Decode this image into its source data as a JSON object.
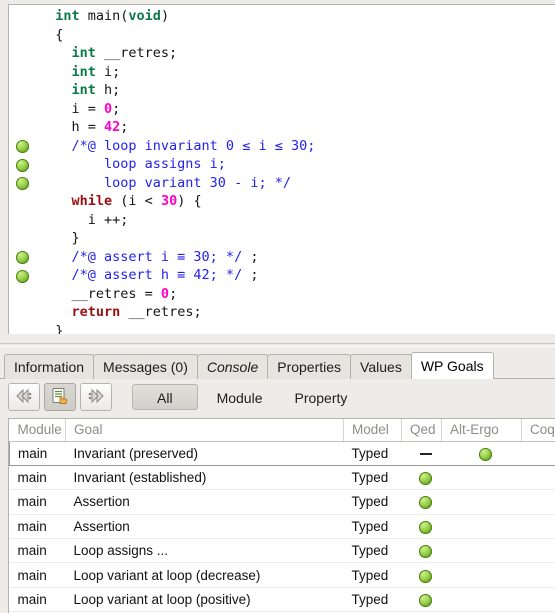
{
  "source": {
    "language": "C",
    "lines": [
      {
        "gutter": false,
        "tokens": [
          {
            "t": "  ",
            "c": "pl"
          },
          {
            "t": "int ",
            "c": "ty"
          },
          {
            "t": "main(",
            "c": "pl"
          },
          {
            "t": "void",
            "c": "ty"
          },
          {
            "t": ")",
            "c": "pl"
          }
        ]
      },
      {
        "gutter": false,
        "tokens": [
          {
            "t": "  {",
            "c": "pl"
          }
        ]
      },
      {
        "gutter": false,
        "tokens": [
          {
            "t": "    ",
            "c": "pl"
          },
          {
            "t": "int",
            "c": "ty"
          },
          {
            "t": " __retres;",
            "c": "pl"
          }
        ]
      },
      {
        "gutter": false,
        "tokens": [
          {
            "t": "    ",
            "c": "pl"
          },
          {
            "t": "int",
            "c": "ty"
          },
          {
            "t": " i;",
            "c": "pl"
          }
        ]
      },
      {
        "gutter": false,
        "tokens": [
          {
            "t": "    ",
            "c": "pl"
          },
          {
            "t": "int",
            "c": "ty"
          },
          {
            "t": " h;",
            "c": "pl"
          }
        ]
      },
      {
        "gutter": false,
        "tokens": [
          {
            "t": "    i = ",
            "c": "pl"
          },
          {
            "t": "0",
            "c": "num"
          },
          {
            "t": ";",
            "c": "pl"
          }
        ]
      },
      {
        "gutter": false,
        "tokens": [
          {
            "t": "    h = ",
            "c": "pl"
          },
          {
            "t": "42",
            "c": "num"
          },
          {
            "t": ";",
            "c": "pl"
          }
        ]
      },
      {
        "gutter": true,
        "tokens": [
          {
            "t": "    /*@ loop invariant 0 ≤ i ≤ 30;",
            "c": "acsl"
          }
        ]
      },
      {
        "gutter": true,
        "tokens": [
          {
            "t": "        loop assigns i;",
            "c": "acsl"
          }
        ]
      },
      {
        "gutter": true,
        "tokens": [
          {
            "t": "        loop variant 30 - i; */",
            "c": "acsl"
          }
        ]
      },
      {
        "gutter": false,
        "tokens": [
          {
            "t": "    ",
            "c": "pl"
          },
          {
            "t": "while",
            "c": "kw"
          },
          {
            "t": " (i < ",
            "c": "pl"
          },
          {
            "t": "30",
            "c": "num"
          },
          {
            "t": ") {",
            "c": "pl"
          }
        ]
      },
      {
        "gutter": false,
        "tokens": [
          {
            "t": "      i ++;",
            "c": "pl"
          }
        ]
      },
      {
        "gutter": false,
        "tokens": [
          {
            "t": "    }",
            "c": "pl"
          }
        ]
      },
      {
        "gutter": true,
        "tokens": [
          {
            "t": "    /*@ assert i ≡ 30; */",
            "c": "acsl"
          },
          {
            "t": " ;",
            "c": "pl"
          }
        ]
      },
      {
        "gutter": true,
        "tokens": [
          {
            "t": "    /*@ assert h ≡ 42; */",
            "c": "acsl"
          },
          {
            "t": " ;",
            "c": "pl"
          }
        ]
      },
      {
        "gutter": false,
        "tokens": [
          {
            "t": "    __retres = ",
            "c": "pl"
          },
          {
            "t": "0",
            "c": "num"
          },
          {
            "t": ";",
            "c": "pl"
          }
        ]
      },
      {
        "gutter": false,
        "tokens": [
          {
            "t": "    ",
            "c": "pl"
          },
          {
            "t": "return",
            "c": "kw"
          },
          {
            "t": " __retres;",
            "c": "pl"
          }
        ]
      },
      {
        "gutter": false,
        "tokens": [
          {
            "t": "  }",
            "c": "pl"
          }
        ]
      }
    ]
  },
  "dock": {
    "tabs": [
      {
        "label": "Information",
        "active": false,
        "italic": false
      },
      {
        "label": "Messages (0)",
        "active": false,
        "italic": false
      },
      {
        "label": "Console",
        "active": false,
        "italic": true
      },
      {
        "label": "Properties",
        "active": false,
        "italic": false
      },
      {
        "label": "Values",
        "active": false,
        "italic": false
      },
      {
        "label": "WP Goals",
        "active": true,
        "italic": false
      }
    ],
    "toolbar": {
      "back_icon": "previous-goal-icon",
      "inspect_icon": "goal-source-icon",
      "forward_icon": "next-goal-icon",
      "scope_all": "All",
      "scope_module": "Module",
      "scope_property": "Property"
    },
    "table": {
      "columns": [
        "Module",
        "Goal",
        "Model",
        "Qed",
        "Alt-Ergo",
        "Coq"
      ],
      "rows": [
        {
          "module": "main",
          "goal": "Invariant (preserved)",
          "model": "Typed",
          "qed": "dash",
          "alt_ergo": "valid",
          "coq": "",
          "selected": true
        },
        {
          "module": "main",
          "goal": "Invariant (established)",
          "model": "Typed",
          "qed": "valid",
          "alt_ergo": "",
          "coq": "",
          "selected": false
        },
        {
          "module": "main",
          "goal": "Assertion",
          "model": "Typed",
          "qed": "valid",
          "alt_ergo": "",
          "coq": "",
          "selected": false
        },
        {
          "module": "main",
          "goal": "Assertion",
          "model": "Typed",
          "qed": "valid",
          "alt_ergo": "",
          "coq": "",
          "selected": false
        },
        {
          "module": "main",
          "goal": "Loop assigns ...",
          "model": "Typed",
          "qed": "valid",
          "alt_ergo": "",
          "coq": "",
          "selected": false
        },
        {
          "module": "main",
          "goal": "Loop variant at loop (decrease)",
          "model": "Typed",
          "qed": "valid",
          "alt_ergo": "",
          "coq": "",
          "selected": false
        },
        {
          "module": "main",
          "goal": "Loop variant at loop (positive)",
          "model": "Typed",
          "qed": "valid",
          "alt_ergo": "",
          "coq": "",
          "selected": false
        }
      ]
    }
  },
  "colors": {
    "keyword": "#9a1010",
    "type": "#0a7a4a",
    "literal": "#ff00c8",
    "annotation": "#2222ee",
    "proved": "#7cc026",
    "chrome": "#edece8"
  }
}
